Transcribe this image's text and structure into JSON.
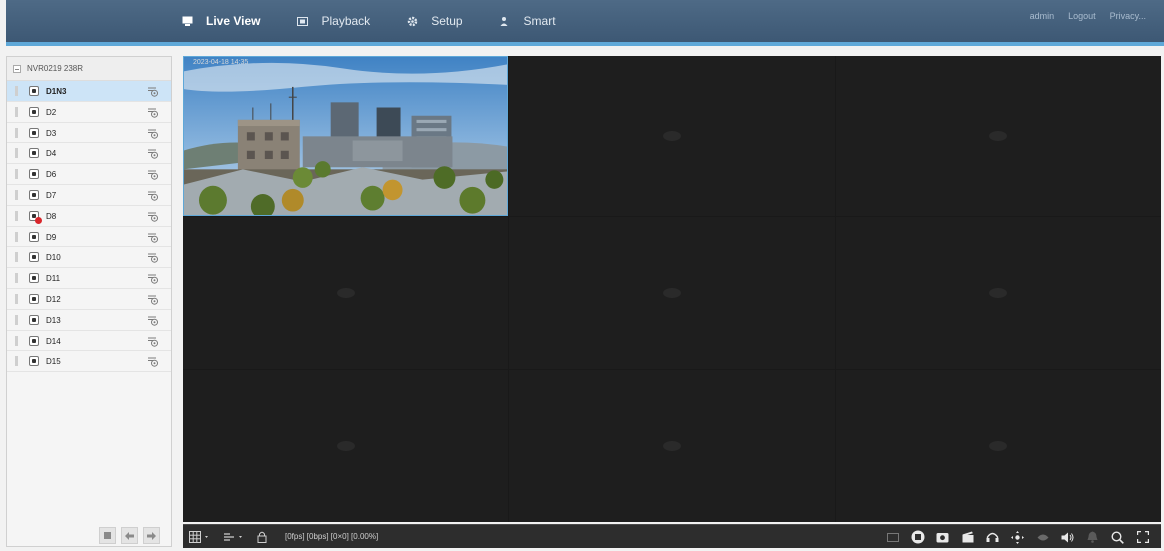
{
  "nav": {
    "items": [
      {
        "label": "Live View",
        "icon": "monitor-icon"
      },
      {
        "label": "Playback",
        "icon": "film-icon"
      },
      {
        "label": "Setup",
        "icon": "gear-icon"
      },
      {
        "label": "Smart",
        "icon": "smart-person-icon"
      }
    ],
    "active": "Live View",
    "links": [
      "admin",
      "Logout",
      "Privacy..."
    ]
  },
  "device_tree": {
    "root_label": "NVR0219 238R",
    "channels": [
      {
        "name": "D1N3",
        "selected": true
      },
      {
        "name": "D2"
      },
      {
        "name": "D3"
      },
      {
        "name": "D4"
      },
      {
        "name": "D6"
      },
      {
        "name": "D7"
      },
      {
        "name": "D8",
        "alarm": true
      },
      {
        "name": "D9"
      },
      {
        "name": "D10"
      },
      {
        "name": "D11"
      },
      {
        "name": "D12"
      },
      {
        "name": "D13"
      },
      {
        "name": "D14"
      },
      {
        "name": "D15"
      }
    ]
  },
  "live_view": {
    "layout": "3x3",
    "active_tile_osd": "2023-04-18 14:35",
    "status": "[0fps] [0bps] [0×0] [0.00%]"
  },
  "colors": {
    "accent": "#5fa8d8",
    "topbar": "#445f7b",
    "selected_row": "#cde4f7",
    "alarm": "#d9262b"
  }
}
